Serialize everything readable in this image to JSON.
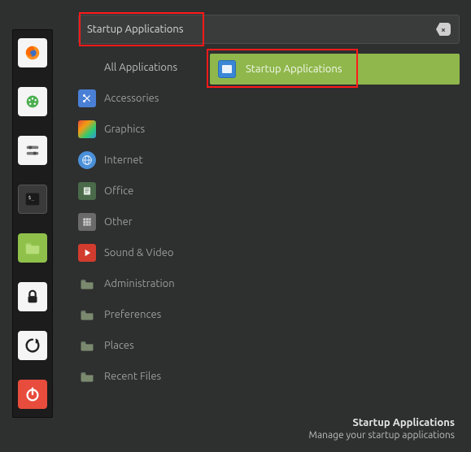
{
  "search": {
    "value": "Startup Applications"
  },
  "categories": [
    {
      "label": "All Applications"
    },
    {
      "label": "Accessories"
    },
    {
      "label": "Graphics"
    },
    {
      "label": "Internet"
    },
    {
      "label": "Office"
    },
    {
      "label": "Other"
    },
    {
      "label": "Sound & Video"
    },
    {
      "label": "Administration"
    },
    {
      "label": "Preferences"
    },
    {
      "label": "Places"
    },
    {
      "label": "Recent Files"
    }
  ],
  "result": {
    "label": "Startup Applications"
  },
  "description": {
    "title": "Startup Applications",
    "subtitle": "Manage your startup applications"
  }
}
